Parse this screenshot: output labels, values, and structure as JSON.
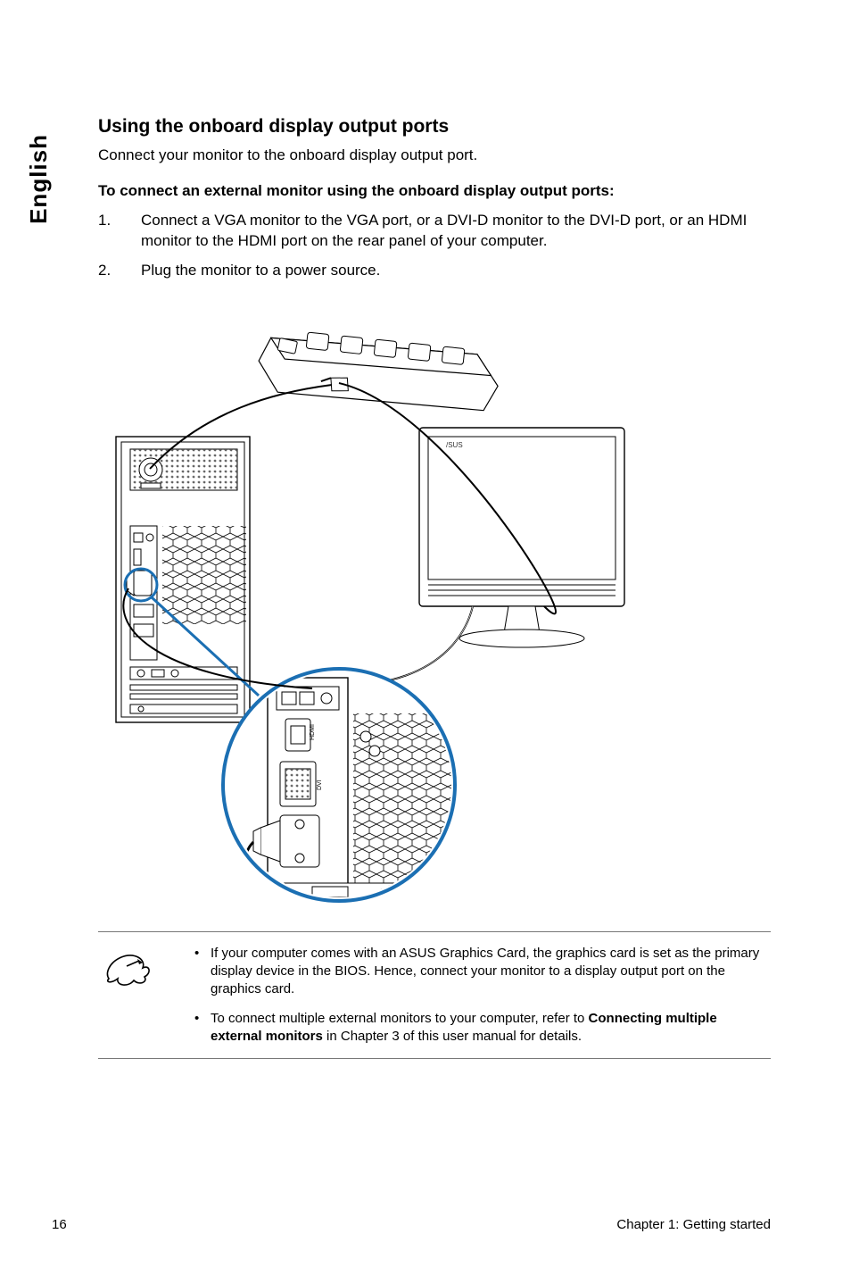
{
  "side_tab": "English",
  "heading": "Using the onboard display output ports",
  "intro": "Connect your monitor to the onboard display output port.",
  "sub_heading": "To connect an external monitor using the onboard display output ports:",
  "steps": [
    "Connect a VGA monitor to the VGA port, or a DVI-D monitor to the DVI-D port, or an HDMI monitor to the HDMI port on the rear panel of your computer.",
    "Plug the monitor to a power source."
  ],
  "notes": {
    "item1_pre": "If your computer comes with an ASUS Graphics Card, the graphics card is set as the primary display device in the BIOS. Hence, connect your monitor to a display output port on the graphics card.",
    "item2_pre": "To connect multiple external monitors to your computer, refer to ",
    "item2_bold": "Connecting multiple external monitors",
    "item2_post": " in Chapter 3 of this user manual for details."
  },
  "footer": {
    "page_number": "16",
    "chapter": "Chapter 1: Getting started"
  }
}
